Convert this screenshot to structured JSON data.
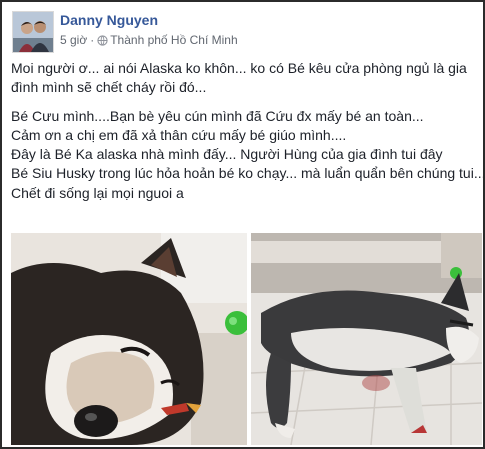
{
  "post": {
    "author": "Danny Nguyen",
    "time": "5 giờ",
    "separator": "·",
    "location": "Thành phố Hồ Chí Minh",
    "privacy_icon": "globe-icon",
    "paragraphs": [
      [
        "Moi người ơ... ai nói Alaska ko khôn... ko có Bé kêu cửa phòng ngủ là gia",
        "đình mình sẽ chết cháy rồi đó..."
      ],
      [
        "Bé Cưu mình....Bạn bè yêu cún mình đã Cứu đx mấy bé an toàn...",
        "Cảm ơn a chị em đã xả thân cứu mấy bé giúo mình....",
        "Đây là Bé Ka alaska nhà mình đấy... Người Hùng của gia đình tui đây",
        "Bé Siu Husky trong lúc hỏa hoản bé ko chạy... mà luẩn quẩn bên chúng tui...",
        "Chết đi sống lại mọi nguoi a"
      ]
    ],
    "photos": [
      {
        "subject": "alaska-dog-lying",
        "colors": {
          "fur": "#2b2522",
          "bg": "#e9e4de"
        }
      },
      {
        "subject": "husky-dog-on-tiles",
        "colors": {
          "fur": "#3a3a3c",
          "bg": "#cfcbc6"
        }
      }
    ]
  },
  "colors": {
    "author": "#365899",
    "meta": "#616770",
    "text": "#1d2129",
    "frame": "#2b2b2b"
  }
}
